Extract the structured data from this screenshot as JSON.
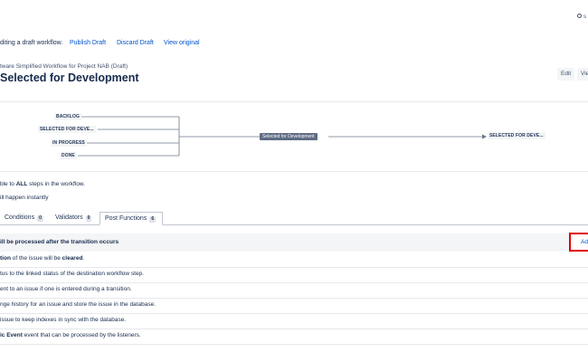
{
  "top_right": {
    "icon": "search-icon",
    "text": "s"
  },
  "draft_bar": {
    "message": "diting a draft workflow.",
    "publish": "Publish Draft",
    "discard": "Discard Draft",
    "view_original": "View original"
  },
  "header": {
    "breadcrumb": "tware Simplified Workflow for Project NAB (Draft)",
    "title": "Selected for Development",
    "edit_label": "Edit",
    "view_label": "Vie"
  },
  "diagram": {
    "sources": [
      "BACKLOG",
      "SELECTED FOR DEVE...",
      "IN PROGRESS",
      "DONE"
    ],
    "transition": "Selected for Development",
    "target": "SELECTED FOR DEVE..."
  },
  "info": {
    "line1_pre": "ble to ",
    "line1_bold": "ALL",
    "line1_post": " steps in the workflow.",
    "line2": "ill happen instantly"
  },
  "tabs": [
    {
      "label": "Conditions",
      "count": "0"
    },
    {
      "label": "Validators",
      "count": "0"
    },
    {
      "label": "Post Functions",
      "count": "6"
    }
  ],
  "post_functions": {
    "header": "ill be processed after the transition occurs",
    "add_label": "Ad",
    "rows": [
      {
        "pre": "",
        "bold": "tion",
        "mid": " of the issue will be ",
        "bold2": "cleared",
        "post": "."
      },
      {
        "pre": "tus to the linked status of the destination workflow step.",
        "bold": "",
        "mid": "",
        "bold2": "",
        "post": ""
      },
      {
        "pre": "ent to an issue if one is entered during a transition.",
        "bold": "",
        "mid": "",
        "bold2": "",
        "post": ""
      },
      {
        "pre": "nge history for an issue and store the issue in the database.",
        "bold": "",
        "mid": "",
        "bold2": "",
        "post": ""
      },
      {
        "pre": "issue to keep indexes in sync with the database.",
        "bold": "",
        "mid": "",
        "bold2": "",
        "post": ""
      },
      {
        "pre": "",
        "bold": "ic Event",
        "mid": " event that can be processed by the listeners.",
        "bold2": "",
        "post": ""
      }
    ]
  },
  "colors": {
    "link": "#0052cc",
    "highlight": "#e00000",
    "transition_label_bg": "#5e6c84"
  }
}
